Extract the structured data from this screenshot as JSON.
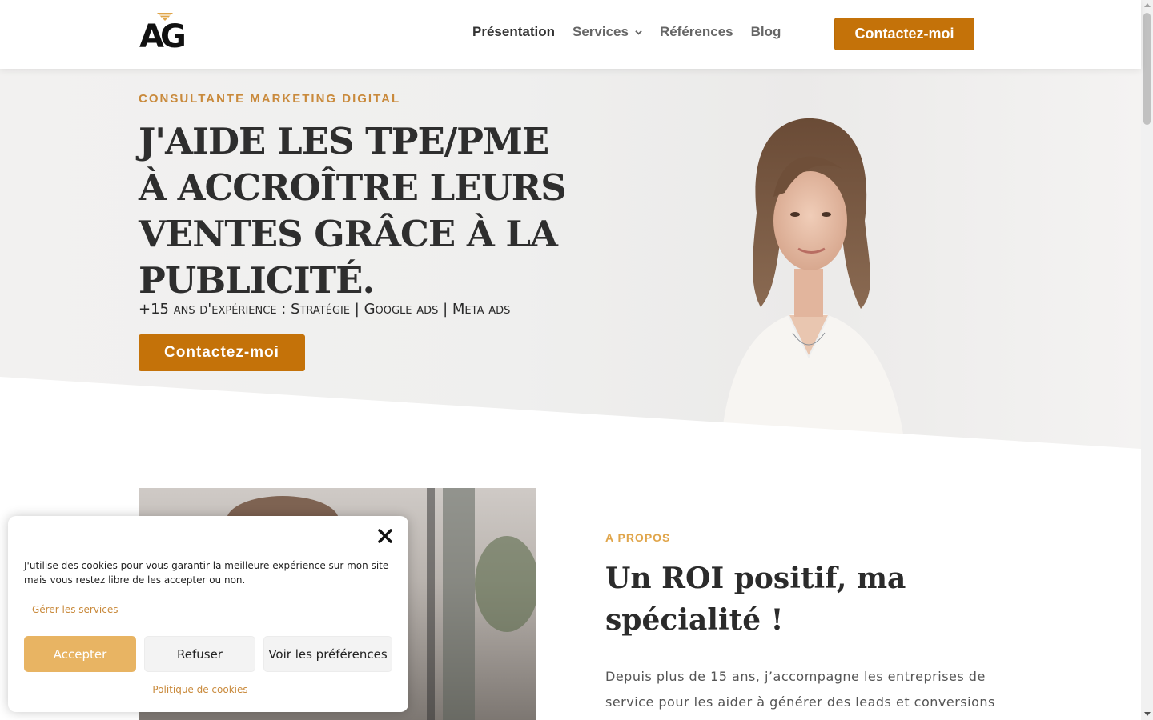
{
  "header": {
    "logo_text": "AG",
    "nav": [
      {
        "label": "Présentation"
      },
      {
        "label": "Services"
      },
      {
        "label": "Références"
      },
      {
        "label": "Blog"
      }
    ],
    "cta_label": "Contactez-moi"
  },
  "hero": {
    "eyebrow": "CONSULTANTE MARKETING DIGITAL",
    "title": "J'AIDE LES TPE/PME À ACCROÎTRE LEURS VENTES GRÂCE À LA PUBLICITÉ.",
    "subtitle": "+15 ans d'expérience : Stratégie | Google ads | Meta ads",
    "cta_label": "Contactez-moi"
  },
  "about": {
    "eyebrow": "A PROPOS",
    "title": "Un ROI positif, ma spécialité !",
    "text": "Depuis plus de 15 ans, j’accompagne les entreprises de service pour les aider à générer des leads et conversions"
  },
  "cookie": {
    "message": "J'utilise des cookies pour vous garantir la meilleure expérience sur mon site mais vous restez libre de les accepter ou non.",
    "manage_label": "Gérer les services",
    "accept_label": "Accepter",
    "refuse_label": "Refuser",
    "prefs_label": "Voir les préférences",
    "policy_label": "Politique de cookies"
  },
  "colors": {
    "accent": "#c47209",
    "eyebrow": "#c98a3c",
    "accept": "#e8b463"
  }
}
